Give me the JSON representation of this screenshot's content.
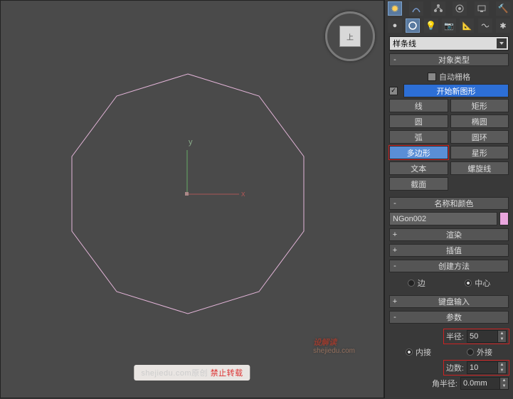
{
  "viewcube": {
    "face_label": "上"
  },
  "watermark": {
    "text_a": "shejiedu.com原创 ",
    "text_b": "禁止转载"
  },
  "big_watermark": {
    "main": "设解读",
    "sub": "shejiedu.com"
  },
  "shape_dropdown": {
    "value": "样条线"
  },
  "rollout": {
    "object_type": "对象类型",
    "auto_grid": "自动栅格",
    "start_new_shape": "开始新图形",
    "line": "线",
    "rectangle": "矩形",
    "circle": "圆",
    "ellipse": "椭圆",
    "arc": "弧",
    "donut": "圆环",
    "ngon": "多边形",
    "star": "星形",
    "text": "文本",
    "helix": "螺旋线",
    "section": "截面",
    "name_color": "名称和颜色",
    "render": "渲染",
    "interpolation": "插值",
    "creation_method": "创建方法",
    "edge": "边",
    "center": "中心",
    "keyboard_entry": "键盘输入",
    "parameters": "参数",
    "radius_label": "半径:",
    "radius_value": "50",
    "inscribed": "内接",
    "circumscribed": "外接",
    "sides_label": "边数:",
    "sides_value": "10",
    "corner_radius_label": "角半径:",
    "corner_radius_value": "0.0mm"
  },
  "object_name": "NGon002"
}
